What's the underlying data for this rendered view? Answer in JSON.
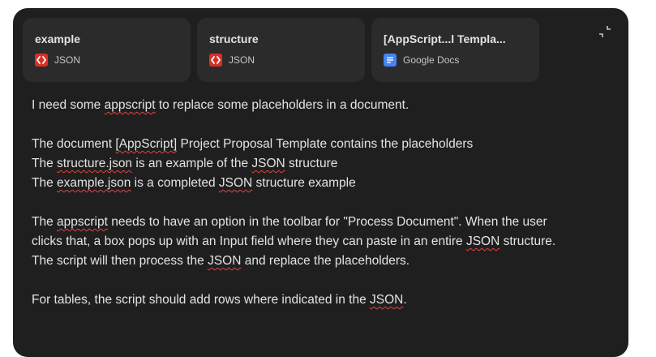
{
  "attachments": [
    {
      "title": "example",
      "type": "JSON"
    },
    {
      "title": "structure",
      "type": "JSON"
    },
    {
      "title": "[AppScript...l Templa...",
      "type": "Google Docs"
    }
  ],
  "message": {
    "line1": {
      "a": "I need some ",
      "b": "appscript",
      "c": " to replace some placeholders in a document."
    },
    "line2": {
      "a": "The document ",
      "b": "[AppScript]",
      "c": " Project Proposal Template contains the placeholders"
    },
    "line3": {
      "a": "The ",
      "b": "structure.json",
      "c": " is an example of the ",
      "d": "JSON",
      "e": " structure"
    },
    "line4": {
      "a": "The ",
      "b": "example.json",
      "c": " is a completed ",
      "d": "JSON",
      "e": " structure example"
    },
    "line5": {
      "a": "The ",
      "b": "appscript",
      "c": " needs to have an option in the toolbar for \"Process Document\". When the user"
    },
    "line6": {
      "a": "clicks that, a box pops up with an Input field where they can paste in an entire ",
      "b": "JSON",
      "c": " structure."
    },
    "line7": {
      "a": "The script will then process the ",
      "b": "JSON",
      "c": " and replace the placeholders."
    },
    "line8": {
      "a": "For tables, the script should add rows where indicated in the ",
      "b": "JSON",
      "c": "."
    }
  },
  "colors": {
    "panel": "#1f1f1f",
    "chip": "#2b2b2b",
    "json_icon": "#d93025",
    "docs_icon": "#4285f4",
    "spellcheck": "#e0443e"
  },
  "icons": {
    "json": "code-brackets-icon",
    "docs": "google-docs-icon",
    "collapse": "collapse-icon"
  }
}
